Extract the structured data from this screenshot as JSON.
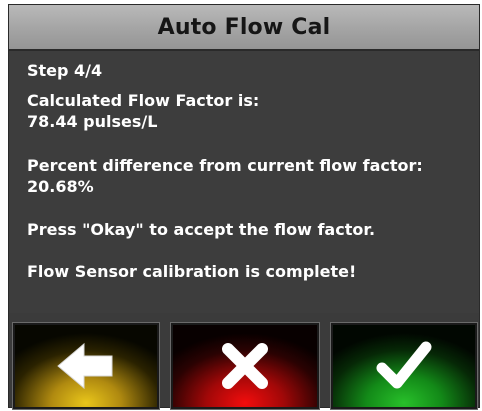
{
  "dialog": {
    "title": "Auto Flow Cal"
  },
  "content": {
    "step": "Step 4/4",
    "flow_factor_label": "Calculated Flow Factor is:",
    "flow_factor_value": "78.44 pulses/L",
    "percent_diff_label": "Percent difference from current flow factor:",
    "percent_diff_value": "20.68%",
    "instruction": "Press \"Okay\" to accept the flow factor.",
    "completion_message": "Flow Sensor calibration is complete!"
  },
  "buttons": {
    "back": {
      "icon": "arrow-left-icon",
      "color": "#e9c61a"
    },
    "cancel": {
      "icon": "close-icon",
      "color": "#f20d0d"
    },
    "okay": {
      "icon": "checkmark-icon",
      "color": "#28c02a"
    }
  }
}
